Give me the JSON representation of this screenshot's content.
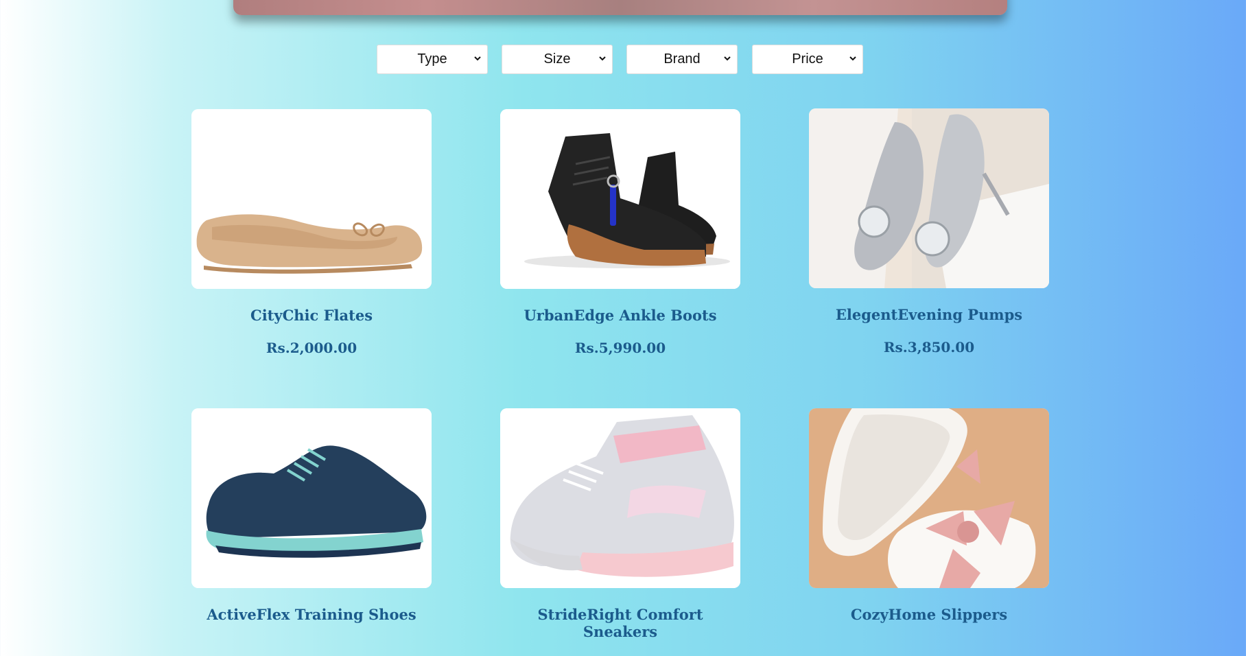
{
  "filters": [
    "Type",
    "Size",
    "Brand",
    "Price"
  ],
  "products": [
    {
      "name": "CityChic Flates",
      "price": "Rs.2,000.00"
    },
    {
      "name": "UrbanEdge Ankle Boots",
      "price": "Rs.5,990.00"
    },
    {
      "name": "ElegentEvening Pumps",
      "price": "Rs.3,850.00"
    },
    {
      "name": "ActiveFlex Training Shoes",
      "price": ""
    },
    {
      "name": "StrideRight Comfort Sneakers",
      "price": ""
    },
    {
      "name": "CozyHome Slippers",
      "price": ""
    }
  ],
  "colors": {
    "text": "#1b5b8c"
  }
}
